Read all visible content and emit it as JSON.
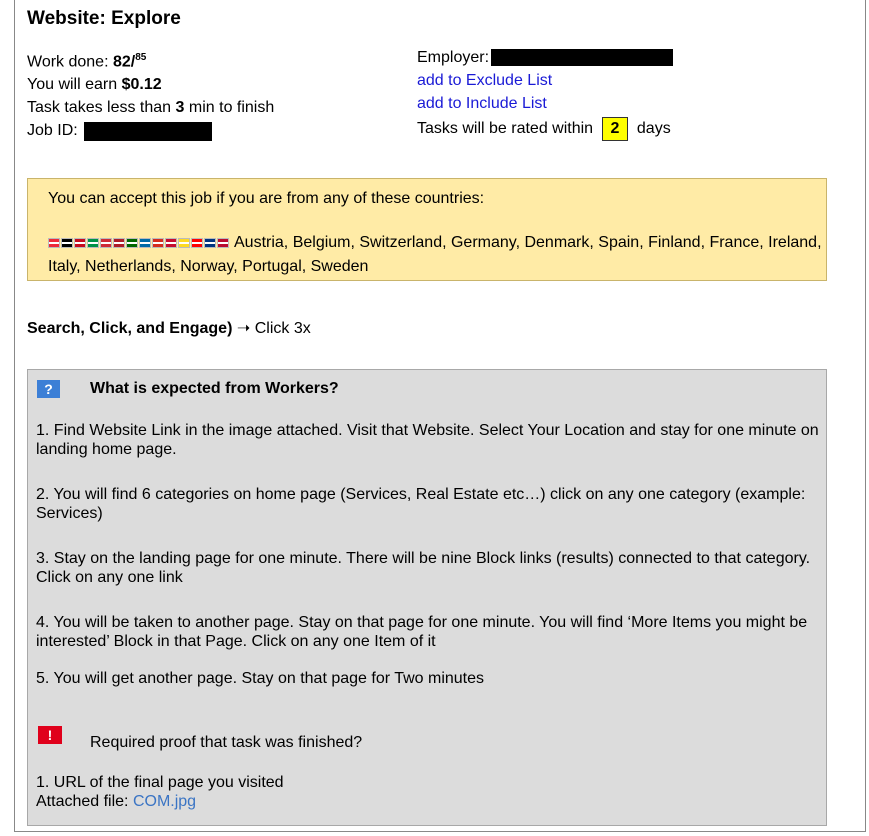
{
  "header": {
    "title": "Website: Explore"
  },
  "job_info": {
    "work_done_label": "Work done:",
    "work_done_value": "82/",
    "work_total": "85",
    "earn_label": "You will earn",
    "earn_value": "$0.12",
    "time_prefix": "Task takes less than",
    "time_value": "3",
    "time_suffix": "min to finish",
    "job_id_label": "Job ID:",
    "employer_label": "Employer:",
    "exclude_link": "add to Exclude List",
    "include_link": "add to Include List",
    "rated_prefix": "Tasks will be rated within",
    "rated_days": "2",
    "rated_suffix": "days"
  },
  "countries": {
    "intro": "You can accept this job if you are from any of these countries:",
    "list": "Austria, Belgium, Switzerland, Germany, Denmark, Spain, Finland, France, Ireland, Italy, Netherlands, Norway, Portugal, Sweden",
    "flag_colors": [
      "#ed2939",
      "#000000",
      "#c60b1e",
      "#009246",
      "#ce2b37",
      "#ae1c28",
      "#006600",
      "#006aa7",
      "#d52b1e",
      "#c60c30",
      "#fdda24",
      "#ff0000",
      "#003580",
      "#ba0c2f"
    ]
  },
  "search": {
    "bold": "Search, Click, and Engage)",
    "arrow": "➝",
    "action": "Click 3x"
  },
  "expected": {
    "icon": "?",
    "title": "What is expected from Workers?",
    "steps": [
      "1. Find Website Link in the image attached. Visit that Website. Select Your Location and stay for one minute on landing home page.",
      "2. You will find 6 categories on home page (Services, Real Estate etc…) click on any one category (example: Services)",
      "3. Stay on the landing page for one minute. There will be nine Block links (results) connected to that category. Click on any one link",
      "4. You will be taken to another page. Stay on that page for one minute. You will find ‘More Items you might be interested’ Block in that Page. Click on any one Item of it",
      "5. You will get another page. Stay on that page for Two minutes"
    ],
    "warn_icon": "!",
    "proof_title": "Required proof that task was finished?",
    "proof_item": "1. URL of the final page you visited",
    "attached_label": "Attached file:",
    "attached_file": "COM.jpg"
  }
}
